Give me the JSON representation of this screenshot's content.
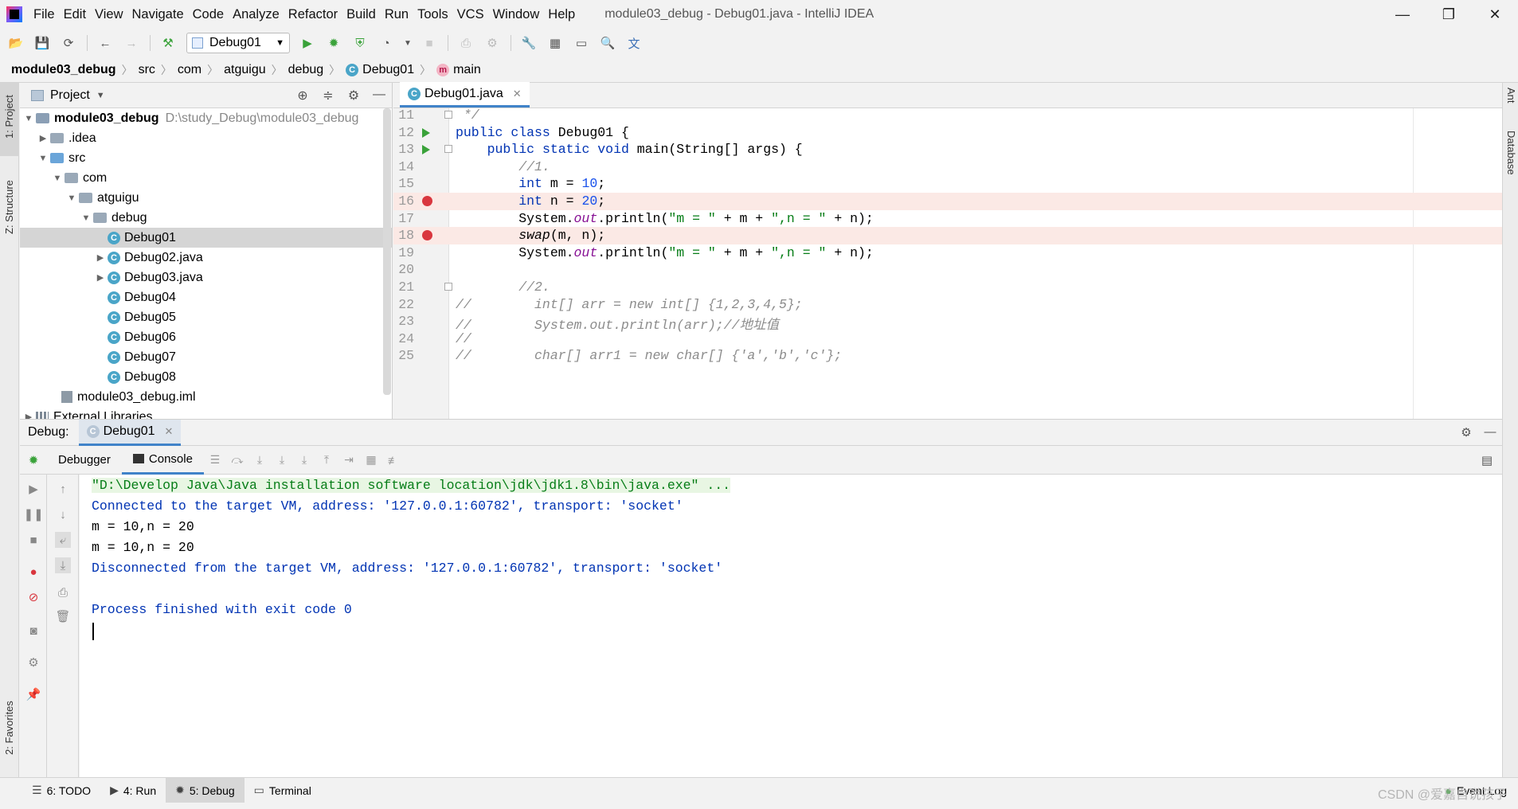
{
  "menu": [
    "File",
    "Edit",
    "View",
    "Navigate",
    "Code",
    "Analyze",
    "Refactor",
    "Build",
    "Run",
    "Tools",
    "VCS",
    "Window",
    "Help"
  ],
  "window_title": "module03_debug - Debug01.java - IntelliJ IDEA",
  "toolbar": {
    "run_config": "Debug01"
  },
  "breadcrumbs": [
    "module03_debug",
    "src",
    "com",
    "atguigu",
    "debug",
    "Debug01",
    "main"
  ],
  "left_stripe": {
    "project": "1: Project",
    "structure": "Z: Structure",
    "favorites": "2: Favorites"
  },
  "right_stripe": {
    "ant": "Ant",
    "database": "Database"
  },
  "project_panel": {
    "title": "Project",
    "root_name": "module03_debug",
    "root_path": "D:\\study_Debug\\module03_debug",
    "items": [
      ".idea",
      "src",
      "com",
      "atguigu",
      "debug",
      "Debug01",
      "Debug02.java",
      "Debug03.java",
      "Debug04",
      "Debug05",
      "Debug06",
      "Debug07",
      "Debug08",
      "module03_debug.iml",
      "External Libraries"
    ]
  },
  "editor": {
    "tab": "Debug01.java",
    "lines": [
      {
        "n": "11",
        "html": " */"
      },
      {
        "n": "12",
        "html": "public class Debug01 {"
      },
      {
        "n": "13",
        "html": "    public static void main(String[] args) {"
      },
      {
        "n": "14",
        "html": "        //1."
      },
      {
        "n": "15",
        "html": "        int m = 10;"
      },
      {
        "n": "16",
        "html": "        int n = 20;"
      },
      {
        "n": "17",
        "html": "        System.out.println(\"m = \" + m + \",n = \" + n);"
      },
      {
        "n": "18",
        "html": "        swap(m, n);"
      },
      {
        "n": "19",
        "html": "        System.out.println(\"m = \" + m + \",n = \" + n);"
      },
      {
        "n": "20",
        "html": ""
      },
      {
        "n": "21",
        "html": "        //2."
      },
      {
        "n": "22",
        "html": "//        int[] arr = new int[] {1,2,3,4,5};"
      },
      {
        "n": "23",
        "html": "//        System.out.println(arr);//地址值"
      },
      {
        "n": "24",
        "html": "//"
      },
      {
        "n": "25",
        "html": "//        char[] arr1 = new char[] {'a','b','c'};"
      }
    ]
  },
  "debug": {
    "label": "Debug:",
    "session_tab": "Debug01",
    "tabs": {
      "debugger": "Debugger",
      "console": "Console"
    },
    "console": [
      "\"D:\\Develop Java\\Java installation software location\\jdk\\jdk1.8\\bin\\java.exe\" ...",
      "Connected to the target VM, address: '127.0.0.1:60782', transport: 'socket'",
      "m = 10,n = 20",
      "m = 10,n = 20",
      "Disconnected from the target VM, address: '127.0.0.1:60782', transport: 'socket'",
      "",
      "Process finished with exit code 0"
    ]
  },
  "bottom_tabs": {
    "todo": "6: TODO",
    "run": "4: Run",
    "debug": "5: Debug",
    "terminal": "Terminal",
    "event_log": "Event Log"
  },
  "watermark": "CSDN @爱嘉自说孩子"
}
